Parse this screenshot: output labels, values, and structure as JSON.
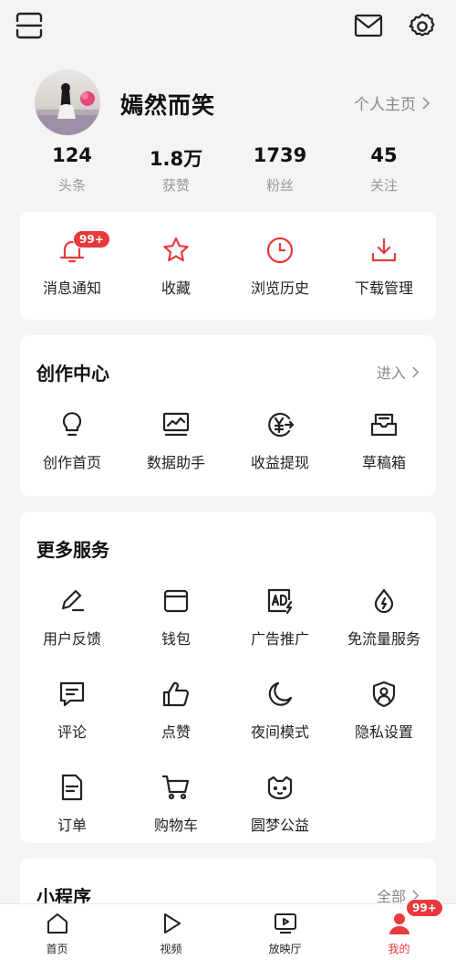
{
  "user": {
    "name": "嫣然而笑",
    "homepage_label": "个人主页"
  },
  "stats": [
    {
      "value": "124",
      "label": "头条"
    },
    {
      "value": "1.8万",
      "label": "获赞"
    },
    {
      "value": "1739",
      "label": "粉丝"
    },
    {
      "value": "45",
      "label": "关注"
    }
  ],
  "quick": {
    "items": [
      {
        "label": "消息通知",
        "icon": "bell-icon",
        "badge": "99+"
      },
      {
        "label": "收藏",
        "icon": "star-icon"
      },
      {
        "label": "浏览历史",
        "icon": "clock-icon"
      },
      {
        "label": "下载管理",
        "icon": "download-icon"
      }
    ]
  },
  "creation": {
    "title": "创作中心",
    "more": "进入",
    "items": [
      {
        "label": "创作首页",
        "icon": "bulb-icon"
      },
      {
        "label": "数据助手",
        "icon": "chart-monitor-icon"
      },
      {
        "label": "收益提现",
        "icon": "yuan-icon"
      },
      {
        "label": "草稿箱",
        "icon": "draft-box-icon"
      }
    ]
  },
  "services": {
    "title": "更多服务",
    "items": [
      {
        "label": "用户反馈",
        "icon": "pen-icon"
      },
      {
        "label": "钱包",
        "icon": "wallet-icon"
      },
      {
        "label": "广告推广",
        "icon": "ad-icon"
      },
      {
        "label": "免流量服务",
        "icon": "drop-icon"
      },
      {
        "label": "评论",
        "icon": "comment-icon"
      },
      {
        "label": "点赞",
        "icon": "thumb-up-icon"
      },
      {
        "label": "夜间模式",
        "icon": "moon-icon"
      },
      {
        "label": "隐私设置",
        "icon": "shield-user-icon"
      },
      {
        "label": "订单",
        "icon": "order-icon"
      },
      {
        "label": "购物车",
        "icon": "cart-icon"
      },
      {
        "label": "圆梦公益",
        "icon": "cat-icon"
      }
    ]
  },
  "mini": {
    "title": "小程序",
    "more": "全部"
  },
  "tabbar": {
    "tabs": [
      {
        "label": "首页",
        "icon": "home-icon"
      },
      {
        "label": "视频",
        "icon": "play-icon"
      },
      {
        "label": "放映厅",
        "icon": "tv-icon"
      },
      {
        "label": "我的",
        "icon": "user-icon",
        "badge": "99+",
        "active": true
      }
    ]
  },
  "colors": {
    "accent": "#e8393c",
    "background": "#f4f4f4",
    "card": "#ffffff"
  }
}
